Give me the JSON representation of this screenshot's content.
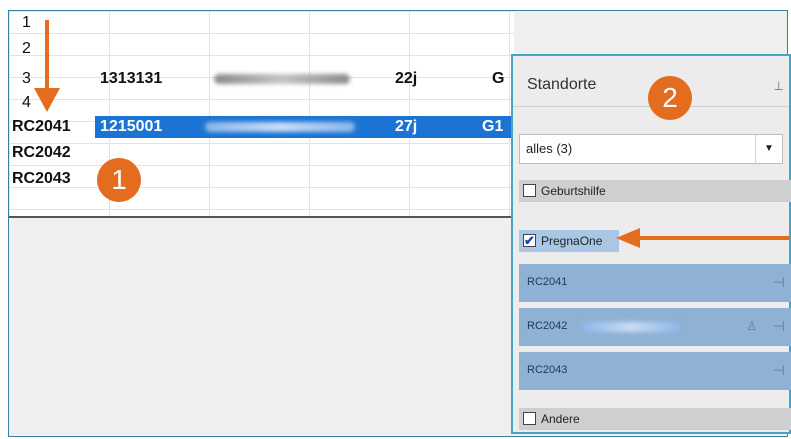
{
  "rows": {
    "row1_label": "1",
    "row2_label": "2",
    "row3_label": "3",
    "row4_label": "4",
    "rc2041": "RC2041",
    "rc2042": "RC2042",
    "rc2043": "RC2043"
  },
  "row3": {
    "id": "1313131",
    "duration": "22j",
    "partial": "G"
  },
  "selected_row": {
    "id": "1215001",
    "duration": "27j",
    "partial": "G1"
  },
  "panel": {
    "title": "Standorte",
    "filter_value": "alles (3)",
    "groups": [
      {
        "label": "Geburtshilfe",
        "checked": false
      },
      {
        "label": "PregnaOne",
        "checked": true
      },
      {
        "label": "Andere",
        "checked": false
      }
    ],
    "devices": [
      {
        "label": "RC2041"
      },
      {
        "label": "RC2042"
      },
      {
        "label": "RC2043"
      }
    ]
  },
  "callouts": {
    "badge_1": "1",
    "badge_2": "2"
  },
  "colors": {
    "accent": "#e46c1e",
    "selection": "#1b74d4",
    "device_item": "#8fb1d3",
    "panel_border": "#4aa3c4"
  },
  "icons": {
    "pin": "pin-icon",
    "person": "person-icon",
    "dropdown": "chevron-down-icon",
    "checkbox_checked": "checkmark-icon"
  }
}
